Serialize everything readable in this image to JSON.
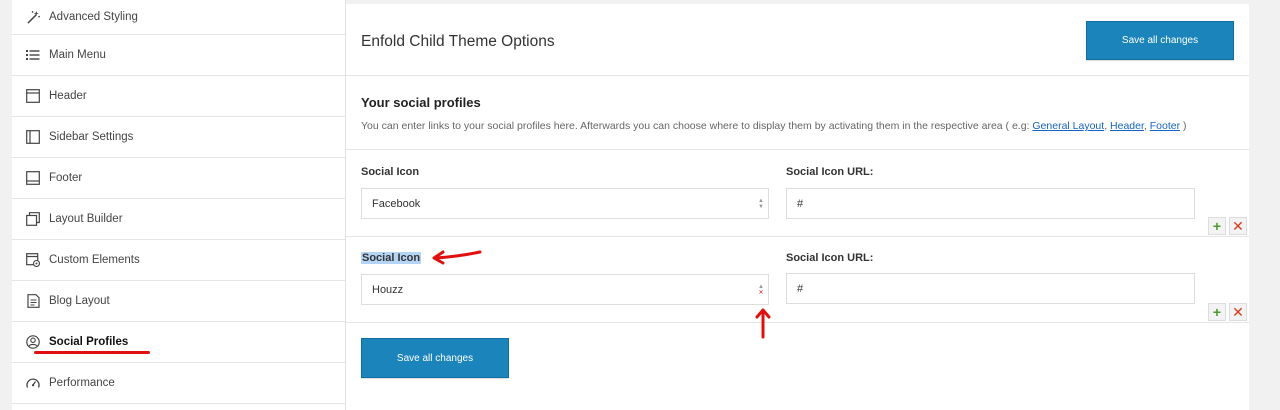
{
  "sidebar": {
    "items": [
      {
        "label": "Advanced Styling",
        "icon": "magic-wand-icon"
      },
      {
        "label": "Main Menu",
        "icon": "list-icon"
      },
      {
        "label": "Header",
        "icon": "header-layout-icon"
      },
      {
        "label": "Sidebar Settings",
        "icon": "sidebar-layout-icon"
      },
      {
        "label": "Footer",
        "icon": "footer-layout-icon"
      },
      {
        "label": "Layout Builder",
        "icon": "layout-builder-icon"
      },
      {
        "label": "Custom Elements",
        "icon": "custom-elements-icon"
      },
      {
        "label": "Blog Layout",
        "icon": "blog-icon"
      },
      {
        "label": "Social Profiles",
        "icon": "user-circle-icon",
        "active": true
      },
      {
        "label": "Performance",
        "icon": "gauge-icon"
      }
    ]
  },
  "header": {
    "title": "Enfold Child Theme Options",
    "save_label": "Save all changes"
  },
  "section": {
    "title": "Your social profiles",
    "desc_prefix": "You can enter links to your social profiles here. Afterwards you can choose where to display them by activating them in the respective area ( e.g: ",
    "link1": "General Layout",
    "sep1": ", ",
    "link2": "Header",
    "sep2": ", ",
    "link3": "Footer",
    "desc_suffix": " )"
  },
  "profiles": [
    {
      "icon_label": "Social Icon",
      "url_label": "Social Icon URL:",
      "icon_value": "Facebook",
      "url_value": "#"
    },
    {
      "icon_label": "Social Icon",
      "url_label": "Social Icon URL:",
      "icon_value": "Houzz",
      "url_value": "#"
    }
  ],
  "footer": {
    "save_label": "Save all changes"
  },
  "colors": {
    "accent": "#1a84bb",
    "annotation": "#e01010",
    "add": "#4b9a2e",
    "remove": "#d63b1c"
  }
}
